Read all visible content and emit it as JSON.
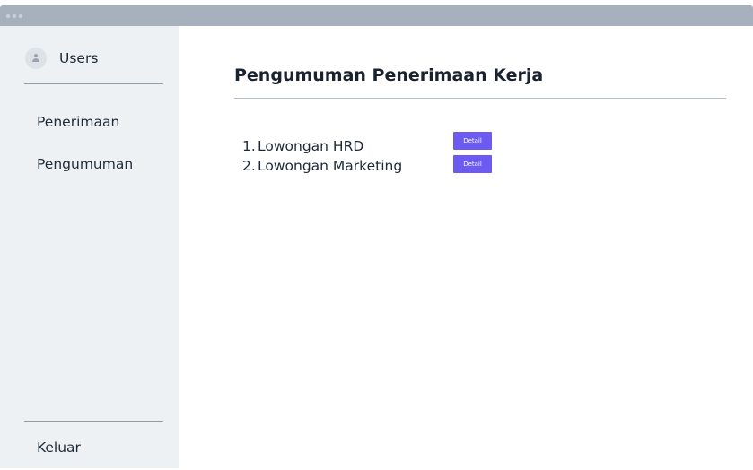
{
  "sidebar": {
    "user_label": "Users",
    "nav_items": [
      {
        "label": "Penerimaan"
      },
      {
        "label": "Pengumuman"
      }
    ],
    "logout_label": "Keluar"
  },
  "main": {
    "title": "Pengumuman Penerimaan Kerja",
    "jobs": [
      {
        "number": "1.",
        "title": "Lowongan HRD",
        "button_label": "Detail"
      },
      {
        "number": "2.",
        "title": "Lowongan Marketing",
        "button_label": "Detail"
      }
    ]
  },
  "colors": {
    "titlebar": "#a7b1bd",
    "sidebar_bg": "#edf1f4",
    "button_accent": "#6d5bf1"
  },
  "icons": {
    "user": "user-icon",
    "window_controls": "window-control-dot"
  }
}
